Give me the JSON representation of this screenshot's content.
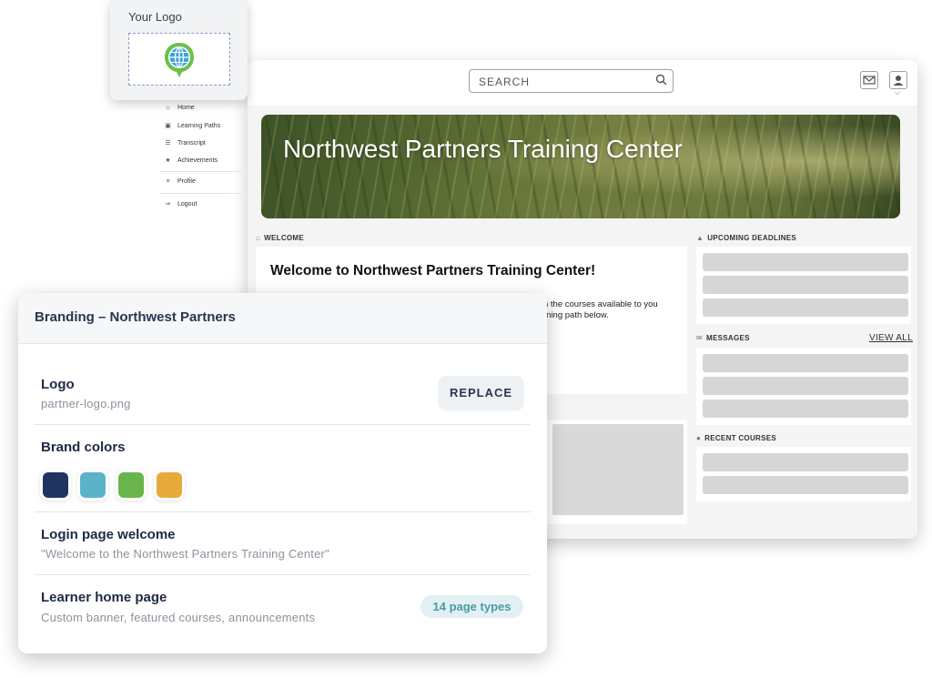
{
  "portal": {
    "search": {
      "placeholder": "SEARCH"
    },
    "banner": {
      "title": "Northwest Partners Training Center"
    },
    "nav": {
      "items": [
        {
          "label": "Home",
          "icon": "home-icon"
        },
        {
          "label": "Learning Paths",
          "icon": "book-icon"
        },
        {
          "label": "Transcript",
          "icon": "list-icon"
        },
        {
          "label": "Achievements",
          "icon": "trophy-icon"
        },
        {
          "label": "Profile",
          "icon": "sliders-icon"
        },
        {
          "label": "Logout",
          "icon": "logout-icon"
        }
      ]
    },
    "welcome": {
      "section_label": "WELCOME",
      "title": "Welcome to Northwest Partners Training Center!",
      "text_line1": "n the courses available to you",
      "text_line2": "rning path below."
    },
    "upcoming": {
      "section_label": "UPCOMING DEADLINES"
    },
    "messages": {
      "section_label": "MESSAGES",
      "view_all": "VIEW ALL"
    },
    "recent": {
      "section_label": "RECENT COURSES"
    }
  },
  "logo_card": {
    "title": "Your Logo"
  },
  "branding": {
    "title": "Branding – Northwest Partners",
    "logo": {
      "title": "Logo",
      "filename": "partner-logo.png",
      "button": "REPLACE"
    },
    "brand_colors": {
      "title": "Brand colors",
      "colors": [
        "#1f3460",
        "#5ab3c9",
        "#69b54a",
        "#e8a93c"
      ]
    },
    "login_welcome": {
      "title": "Login page welcome",
      "text": "\"Welcome to the Northwest Partners Training Center\""
    },
    "learner_home": {
      "title": "Learner home page",
      "text": "Custom banner, featured courses, announcements",
      "badge": "14 page types"
    }
  }
}
